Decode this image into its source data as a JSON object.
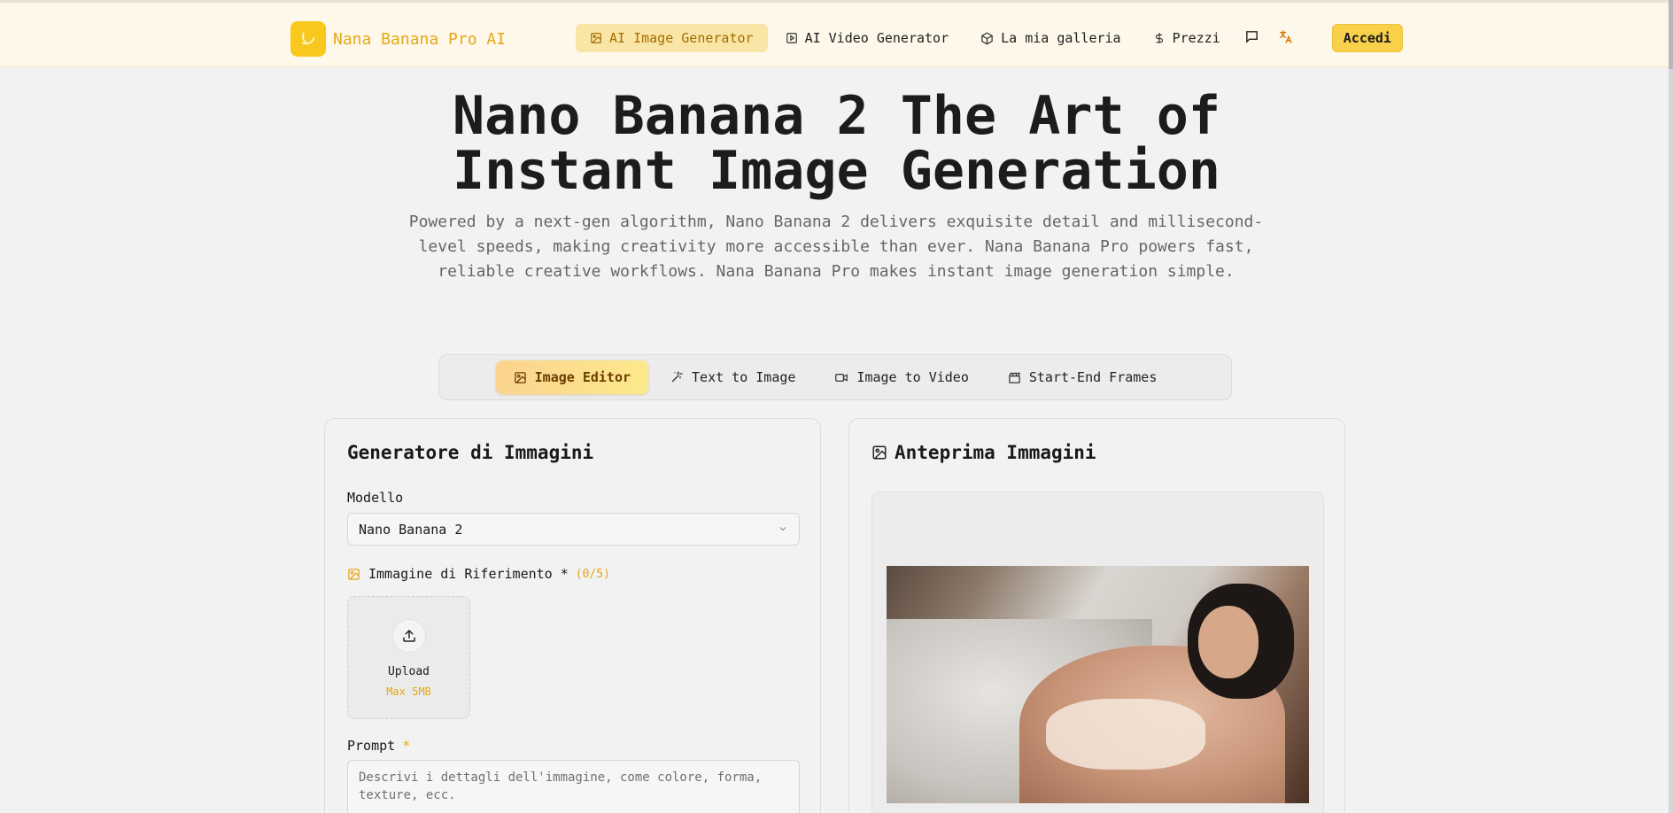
{
  "header": {
    "brand": "Nana Banana Pro AI",
    "nav": [
      {
        "label": "AI Image Generator",
        "icon": "image-icon",
        "active": true
      },
      {
        "label": "AI Video Generator",
        "icon": "play-square-icon",
        "active": false
      },
      {
        "label": "La mia galleria",
        "icon": "cube-icon",
        "active": false
      },
      {
        "label": "Prezzi",
        "icon": "dollar-icon",
        "active": false
      }
    ],
    "login": "Accedi"
  },
  "hero": {
    "title_line1": "Nano Banana 2 The Art of",
    "title_line2": "Instant Image Generation",
    "subtitle": "Powered by a next-gen algorithm, Nano Banana 2 delivers exquisite detail and millisecond-level speeds, making creativity more accessible than ever. Nana Banana Pro powers fast, reliable creative workflows. Nana Banana Pro makes instant image generation simple."
  },
  "tabs": [
    {
      "label": "Image Editor",
      "icon": "image-edit-icon",
      "active": true
    },
    {
      "label": "Text to Image",
      "icon": "sparkles-icon",
      "active": false
    },
    {
      "label": "Image to Video",
      "icon": "video-icon",
      "active": false
    },
    {
      "label": "Start-End Frames",
      "icon": "clapperboard-icon",
      "active": false
    }
  ],
  "generator": {
    "title": "Generatore di Immagini",
    "model_label": "Modello",
    "model_value": "Nano Banana 2",
    "reference_label": "Immagine di Riferimento *",
    "reference_count": "(0/5)",
    "upload_label": "Upload",
    "upload_max": "Max 5MB",
    "prompt_label": "Prompt",
    "prompt_required": "*",
    "prompt_placeholder": "Descrivi i dettagli dell'immagine, come colore, forma, texture, ecc."
  },
  "preview": {
    "title": "Anteprima Immagini"
  },
  "colors": {
    "accent": "#f8c81c",
    "accent_text": "#e6a817",
    "header_bg": "#fdf8e9",
    "page_bg": "#f2f2f2"
  }
}
